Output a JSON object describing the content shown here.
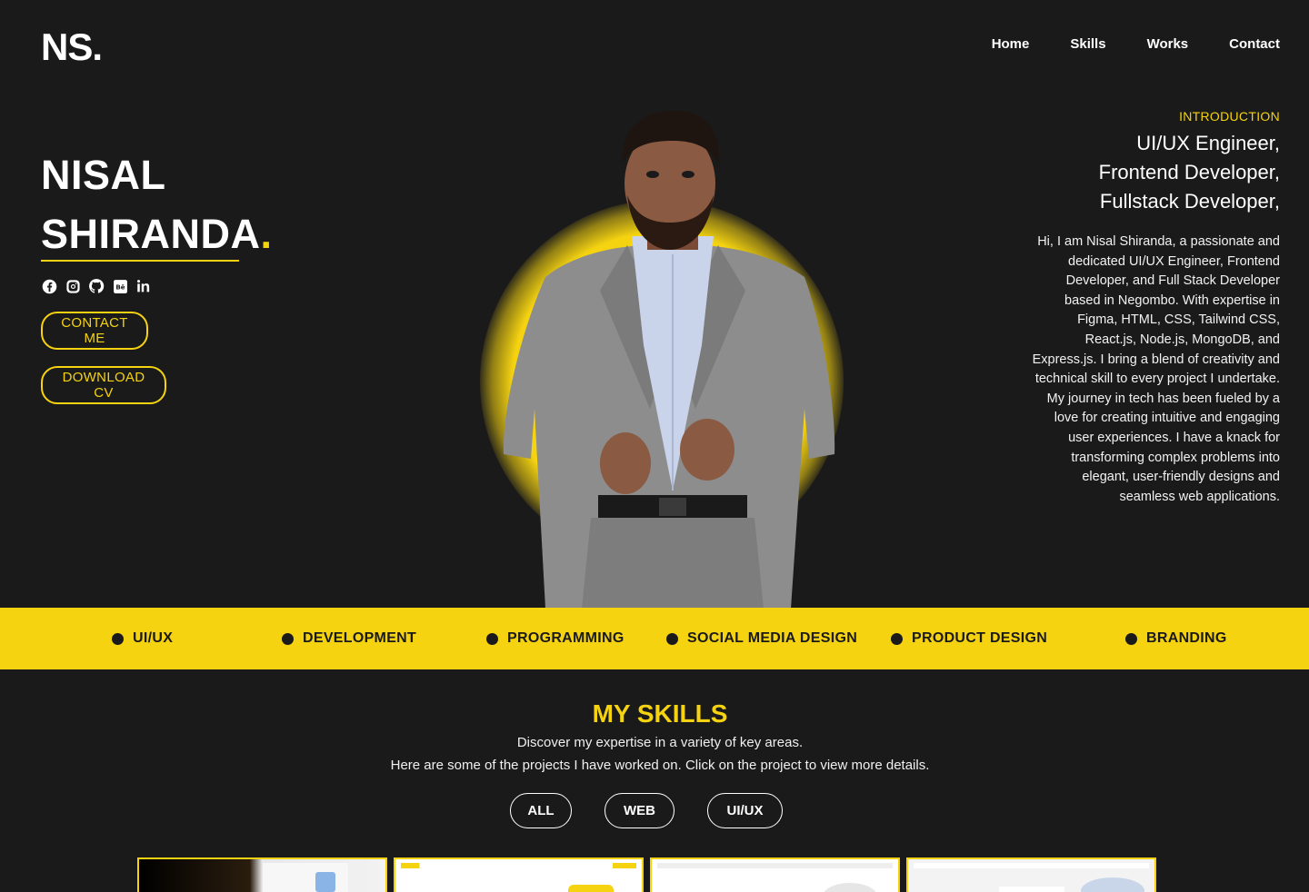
{
  "header": {
    "logo": "NS.",
    "nav": [
      {
        "label": "Home"
      },
      {
        "label": "Skills"
      },
      {
        "label": "Works"
      },
      {
        "label": "Contact"
      }
    ]
  },
  "hero": {
    "first_name": "NISAL",
    "last_name": "SHIRANDA",
    "name_dot": ".",
    "socials": [
      "facebook-icon",
      "instagram-icon",
      "github-icon",
      "behance-icon",
      "linkedin-icon"
    ],
    "contact_button": "CONTACT ME",
    "cv_button": "DOWNLOAD CV"
  },
  "intro": {
    "label": "INTRODUCTION",
    "roles": [
      "UI/UX Engineer,",
      "Frontend Developer,",
      "Fullstack Developer,"
    ],
    "bio": "Hi, I am Nisal Shiranda, a passionate and dedicated UI/UX Engineer, Frontend Developer, and Full Stack Developer based in Negombo. With expertise in Figma, HTML, CSS, Tailwind CSS, React.js, Node.js, MongoDB, and Express.js. I bring a blend of creativity and technical skill to every project I undertake. My journey in tech has been fueled by a love for creating intuitive and engaging user experiences. I have a knack for transforming complex problems into elegant, user-friendly designs and seamless web applications."
  },
  "band": {
    "items": [
      "UI/UX",
      "DEVELOPMENT",
      "PROGRAMMING",
      "SOCIAL MEDIA DESIGN",
      "PRODUCT DESIGN",
      "BRANDING"
    ]
  },
  "skills": {
    "title": "MY SKILLS",
    "subtitle_1": "Discover my expertise in a variety of key areas.",
    "subtitle_2": "Here are some of the projects I have worked on. Click on the project to view more details.",
    "filters": [
      "ALL",
      "WEB",
      "UI/UX"
    ]
  },
  "colors": {
    "accent": "#f5d311",
    "background": "#1a1a1a",
    "text": "#ffffff"
  }
}
